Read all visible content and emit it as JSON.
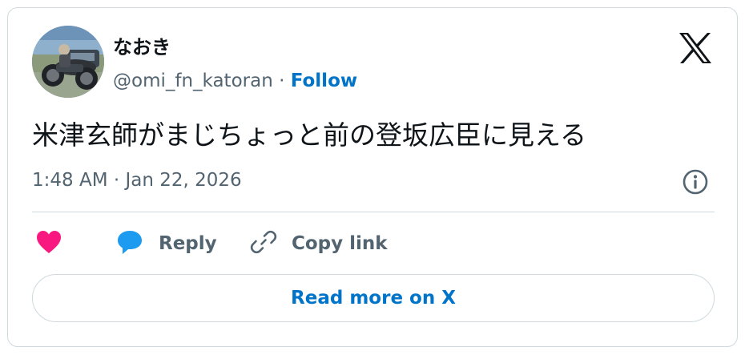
{
  "author": {
    "display_name": "なおき",
    "handle": "@omi_fn_katoran",
    "separator": "·",
    "follow_label": "Follow",
    "avatar_icon": "motorcycle-photo"
  },
  "brand": {
    "logo_icon": "x-logo-icon"
  },
  "tweet": {
    "text": "米津玄師がまじちょっと前の登坂広臣に見える",
    "timestamp": "1:48 AM · Jan 22, 2026"
  },
  "actions": {
    "like_icon": "heart-icon",
    "reply_label": "Reply",
    "reply_icon": "speech-bubble-icon",
    "copy_label": "Copy link",
    "copy_icon": "link-icon",
    "info_icon": "info-icon"
  },
  "read_more": {
    "label": "Read more on X"
  },
  "colors": {
    "accent": "#0074c8",
    "heart": "#f91880",
    "reply_bubble": "#1d9bf0",
    "muted_text": "#536471",
    "border": "#cfd9de"
  }
}
